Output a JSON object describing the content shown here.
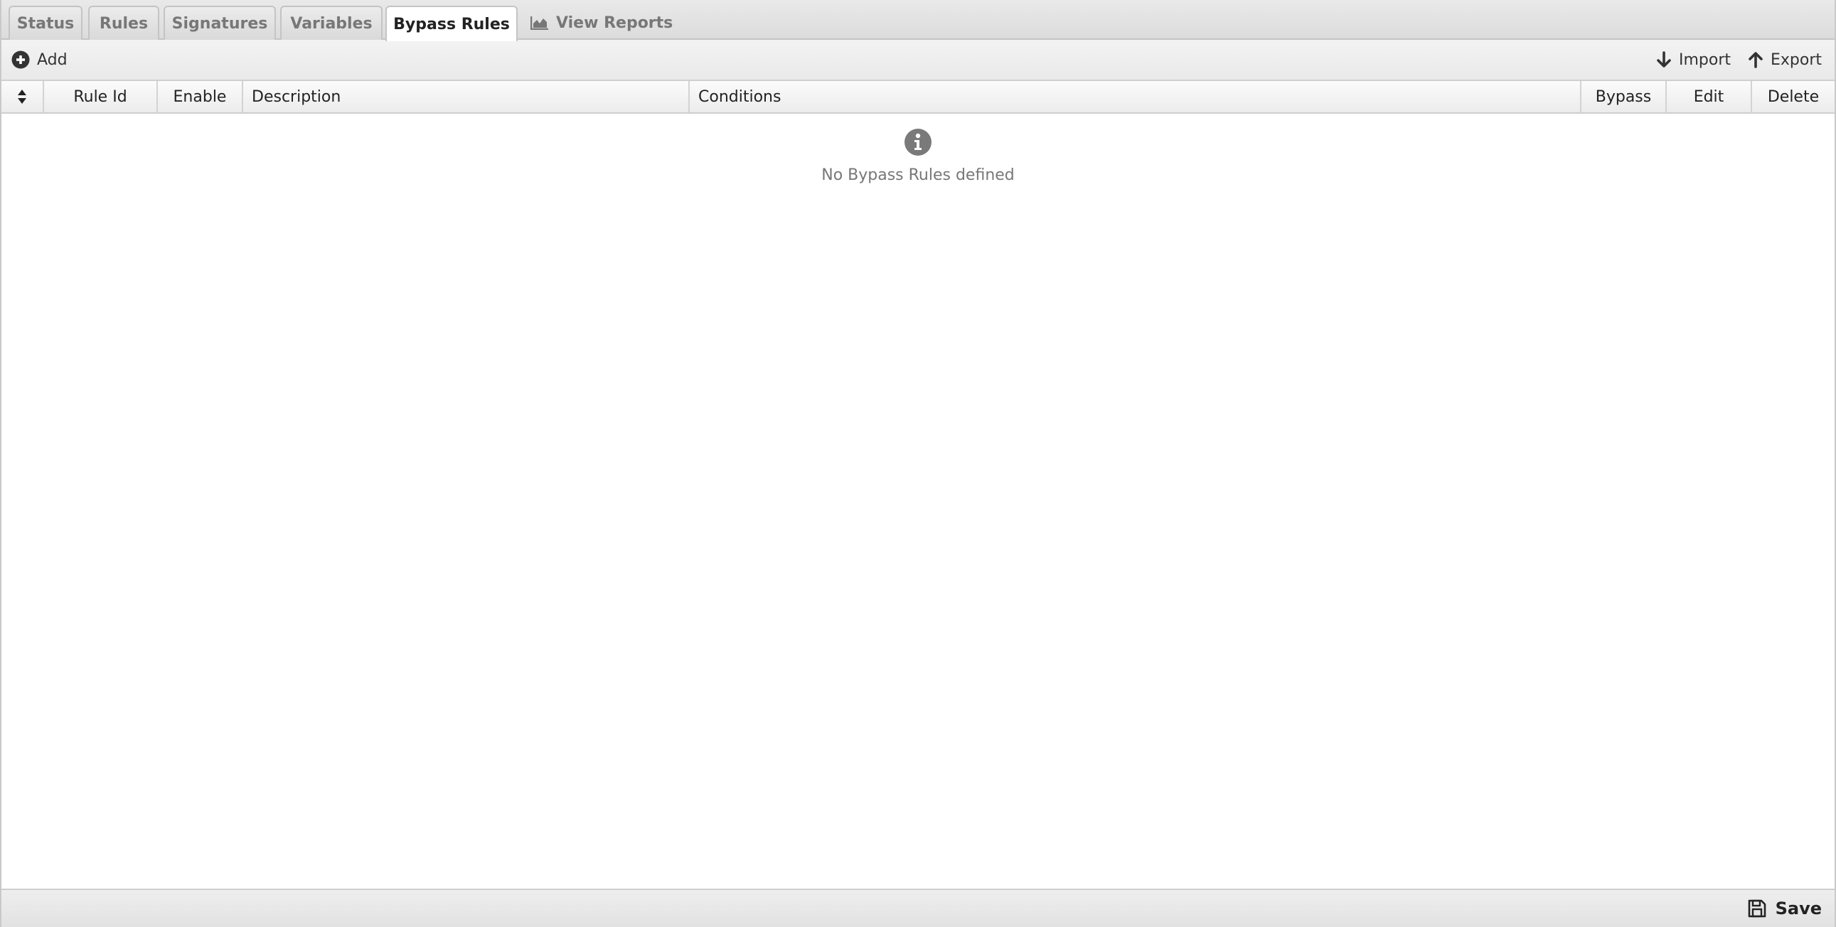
{
  "tabs": [
    {
      "label": "Status",
      "active": false
    },
    {
      "label": "Rules",
      "active": false
    },
    {
      "label": "Signatures",
      "active": false
    },
    {
      "label": "Variables",
      "active": false
    },
    {
      "label": "Bypass Rules",
      "active": true
    },
    {
      "label": "View Reports",
      "active": false,
      "icon": "area-chart-icon"
    }
  ],
  "toolbar": {
    "add_label": "Add",
    "add_icon": "plus-circle-icon",
    "import_label": "Import",
    "import_icon": "arrow-down-icon",
    "export_label": "Export",
    "export_icon": "arrow-up-icon"
  },
  "grid": {
    "sort_icon": "sort-icon",
    "columns": [
      "Rule Id",
      "Enable",
      "Description",
      "Conditions",
      "Bypass",
      "Edit",
      "Delete"
    ],
    "empty_icon": "info-circle-icon",
    "empty_message": "No Bypass Rules defined"
  },
  "footer": {
    "save_label": "Save",
    "save_icon": "floppy-disk-icon"
  }
}
